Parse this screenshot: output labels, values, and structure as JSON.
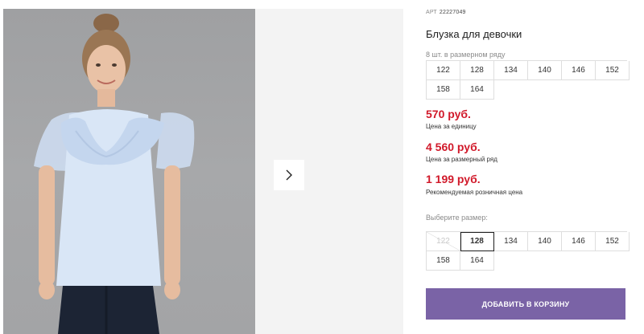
{
  "product": {
    "article_label": "АРТ",
    "article_number": "22227049",
    "title": "Блузка для девочки",
    "row_note": "8 шт. в размерном ряду",
    "row_sizes": [
      "122",
      "128",
      "134",
      "140",
      "146",
      "152",
      "158",
      "164"
    ]
  },
  "prices": [
    {
      "value": "570 руб.",
      "label": "Цена за единицу"
    },
    {
      "value": "4 560 руб.",
      "label": "Цена за размерный ряд"
    },
    {
      "value": "1 199 руб.",
      "label": "Рекомендуемая розничная цена"
    }
  ],
  "size_picker": {
    "label": "Выберите размер:",
    "sizes": [
      {
        "value": "122",
        "state": "disabled"
      },
      {
        "value": "128",
        "state": "selected"
      },
      {
        "value": "134",
        "state": "available"
      },
      {
        "value": "140",
        "state": "available"
      },
      {
        "value": "146",
        "state": "available"
      },
      {
        "value": "152",
        "state": "available"
      },
      {
        "value": "158",
        "state": "available"
      },
      {
        "value": "164",
        "state": "available"
      }
    ]
  },
  "cart_button": {
    "label": "ДОБАВИТЬ В КОРЗИНУ"
  },
  "colors": {
    "price": "#d1192a",
    "cart_button": "#7a63a6",
    "photo_background": "#a3a4a6"
  },
  "icons": {
    "next": "chevron-right-icon"
  }
}
